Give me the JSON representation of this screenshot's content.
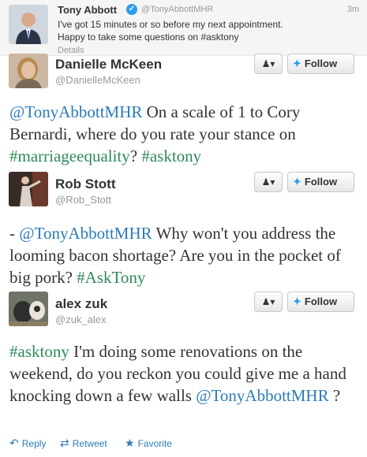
{
  "top_tweet": {
    "name": "Tony Abbott",
    "handle": "@TonyAbbottMHR",
    "time": "3m",
    "text": "I've got 15 minutes or so before my next appointment. Happy to take some questions on #asktony",
    "details": "Details"
  },
  "follow_label": "Follow",
  "replies": [
    {
      "name": "Danielle McKeen",
      "handle": "@DanielleMcKeen",
      "text_parts": [
        "@TonyAbbottMHR",
        " On a scale of 1 to Cory Bernardi, where do you rate your stance on ",
        "#marriageequality",
        "? ",
        "#asktony"
      ]
    },
    {
      "name": "Rob Stott",
      "handle": "@Rob_Stott",
      "text_parts": [
        "- ",
        "@TonyAbbottMHR",
        " Why won't you address the looming bacon shortage? Are you in the pocket of big pork? ",
        "#AskTony"
      ]
    },
    {
      "name": "alex zuk",
      "handle": "@zuk_alex",
      "text_parts": [
        "#asktony",
        " I'm doing some renovations on the weekend, do you reckon you could give me a hand knocking down a few walls ",
        "@TonyAbbottMHR",
        " ?"
      ]
    }
  ],
  "actions": {
    "reply": "Reply",
    "retweet": "Retweet",
    "favorite": "Favorite"
  },
  "colors": {
    "link": "#2b7bb9",
    "hashtag": "#2e8a5a",
    "twitter_blue": "#2b9fe8"
  }
}
